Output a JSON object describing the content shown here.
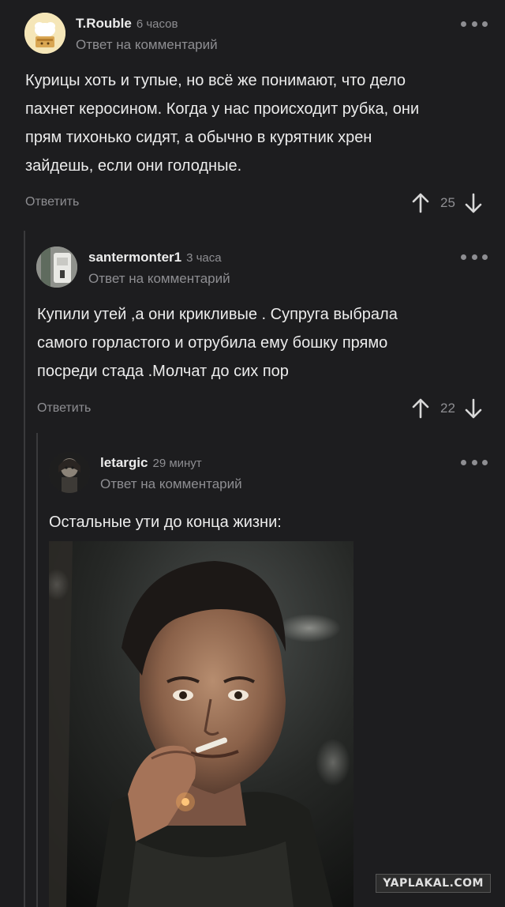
{
  "comments": [
    {
      "author": "T.Rouble",
      "time": "6 часов",
      "reply_to": "Ответ на комментарий",
      "lines": [
        "Курицы хоть и тупые, но всё же понимают, что дело",
        "пахнет керосином. Когда у нас происходит рубка, они",
        "прям тихонько сидят, а обычно в курятник хрен",
        "зайдешь, если они голодные."
      ],
      "reply_label": "Ответить",
      "rating": "25"
    },
    {
      "author": "santermonter1",
      "time": "3 часа",
      "reply_to": "Ответ на комментарий",
      "lines": [
        "Купили утей ,а они крикливые . Супруга выбрала",
        "самого горластого и отрубила ему бошку прямо",
        "посреди стада .Молчат до сих пор"
      ],
      "reply_label": "Ответить",
      "rating": "22"
    },
    {
      "author": "letargic",
      "time": "29 минут",
      "reply_to": "Ответ на комментарий",
      "lines": [
        "Остальные ути до конца жизни:"
      ]
    }
  ],
  "watermark": "YAPLAKAL.COM",
  "icons": {
    "upvote": "arrow-up-icon",
    "downvote": "arrow-down-icon",
    "menu": "more-dots-icon"
  },
  "colors": {
    "background": "#1d1d1f",
    "text": "#ececec",
    "muted": "#8e8e92",
    "thread_line": "#3a3a3c"
  }
}
